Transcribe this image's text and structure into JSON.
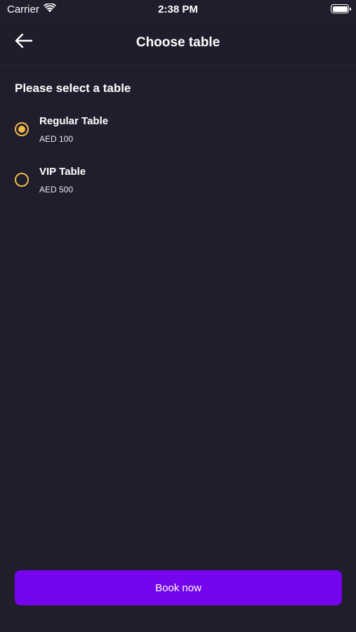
{
  "status_bar": {
    "carrier": "Carrier",
    "time": "2:38 PM",
    "icons": [
      "wifi-icon",
      "battery-icon"
    ]
  },
  "nav": {
    "back_icon": "arrow-left-icon",
    "title": "Choose table"
  },
  "section": {
    "title": "Please select a table"
  },
  "options": [
    {
      "name": "Regular Table",
      "price": "AED 100",
      "selected": true
    },
    {
      "name": "VIP Table",
      "price": "AED 500",
      "selected": false
    }
  ],
  "actions": {
    "book_label": "Book now"
  },
  "colors": {
    "background": "#201e2d",
    "accent": "#f0b84a",
    "primary_button": "#7405ec"
  }
}
